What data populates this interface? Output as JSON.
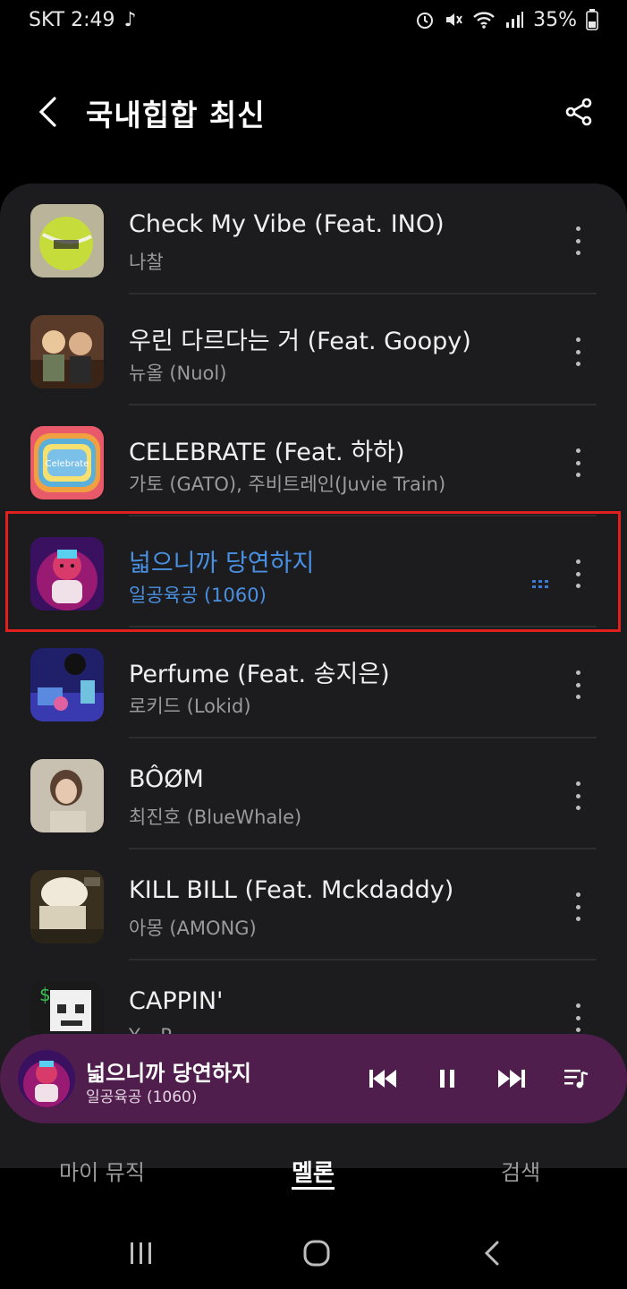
{
  "status_bar": {
    "carrier_time": "SKT 2:49",
    "battery": "35%",
    "icons": [
      "music-note-icon",
      "alarm-icon",
      "mute-icon",
      "wifi-icon",
      "signal-icon",
      "battery-icon"
    ]
  },
  "header": {
    "title": "국내힙합 최신",
    "back_icon": "chevron-left-icon",
    "share_icon": "share-icon"
  },
  "tracks": [
    {
      "title": "Check My Vibe (Feat. INO)",
      "artist": "나찰",
      "art": "tennis-ball"
    },
    {
      "title": "우린 다르다는 거 (Feat. Goopy)",
      "artist": "뉴올 (Nuol)",
      "art": "couple"
    },
    {
      "title": "CELEBRATE (Feat. 하하)",
      "artist": "가토 (GATO), 주비트레인(Juvie Train)",
      "art": "celebrate"
    },
    {
      "title": "넓으니까 당연하지",
      "artist": "일공육공 (1060)",
      "art": "pink-character",
      "playing": true
    },
    {
      "title": "Perfume (Feat. 송지은)",
      "artist": "로키드 (Lokid)",
      "art": "room"
    },
    {
      "title": "BÔØM",
      "artist": "최진호 (BlueWhale)",
      "art": "woman"
    },
    {
      "title": "KILL BILL (Feat. Mckdaddy)",
      "artist": "아몽 (AMONG)",
      "art": "hoodie"
    },
    {
      "title": "CAPPIN'",
      "artist": "Y... P...",
      "art": "pixel-skull"
    }
  ],
  "mini_player": {
    "title": "넓으니까 당연하지",
    "artist": "일공육공 (1060)",
    "controls": [
      "previous-icon",
      "pause-icon",
      "next-icon",
      "playlist-icon"
    ]
  },
  "tabs": {
    "my_music": "마이 뮤직",
    "melon": "멜론",
    "search": "검색",
    "active": "melon"
  },
  "colors": {
    "playing_accent": "#4a90e2",
    "mini_player_bg": "#4f1e4d",
    "highlight": "#e0201f"
  }
}
